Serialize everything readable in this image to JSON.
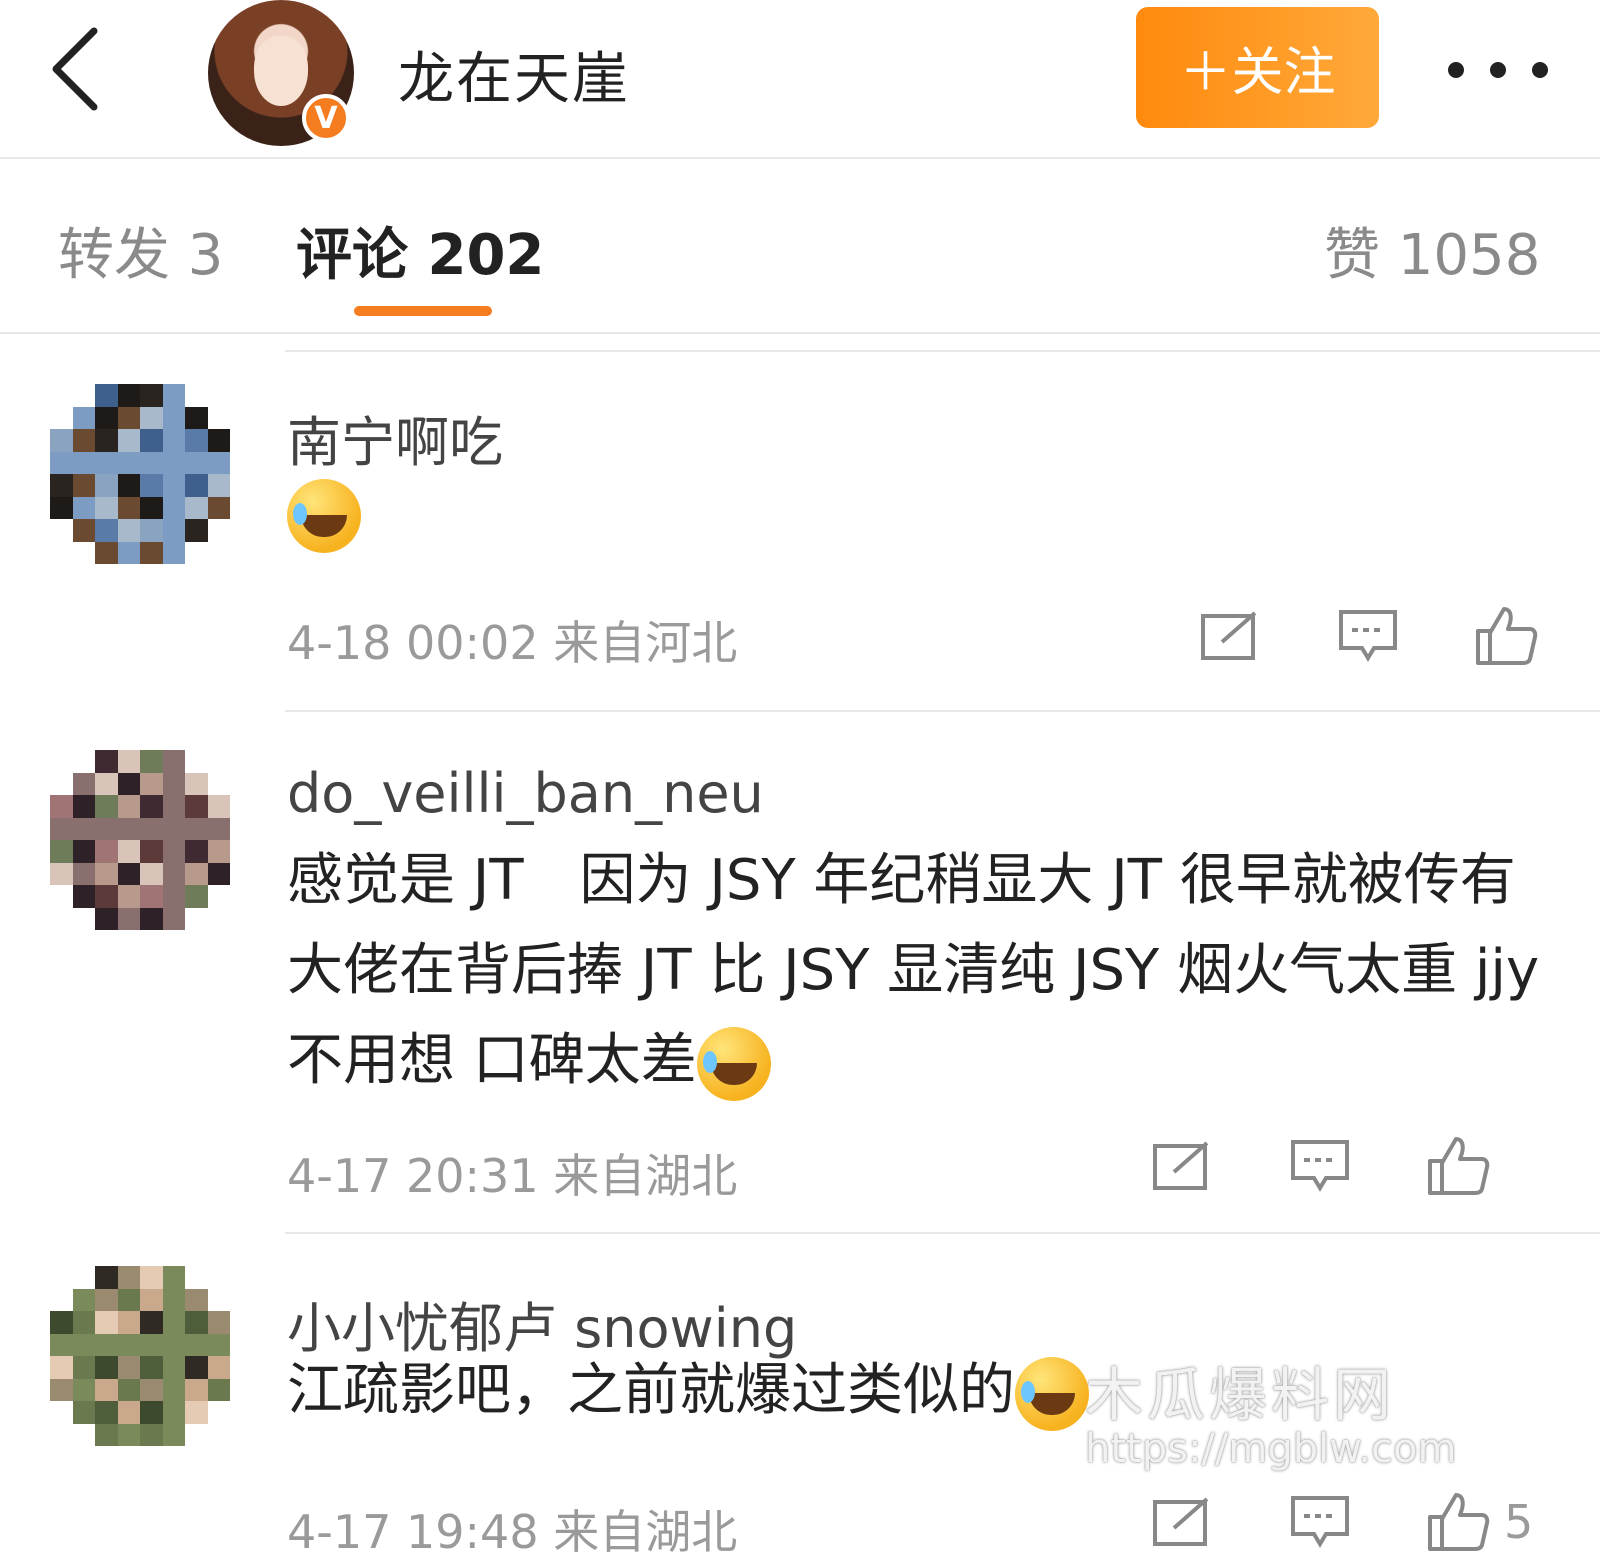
{
  "header": {
    "title": "龙在天崖",
    "verified_badge": "V",
    "follow_label": "＋关注"
  },
  "tabs": [
    {
      "label": "转发 3"
    },
    {
      "label": "评论 202"
    },
    {
      "label": "赞 1058"
    }
  ],
  "comments": [
    {
      "user": "南宁啊吃",
      "text": "",
      "time": "4-18 00:02",
      "source": "来自河北",
      "likes": ""
    },
    {
      "user": "do_veilli_ban_neu",
      "text": "感觉是 JT　因为 JSY 年纪稍显大 JT 很早就被传有大佬在背后捧 JT 比 JSY 显清纯 JSY 烟火气太重 jjy 不用想 口碑太差",
      "time": "4-17 20:31",
      "source": "来自湖北",
      "likes": ""
    },
    {
      "user": "小小忧郁卢 snowing",
      "text": "江疏影吧，之前就爆过类似的",
      "time": "4-17 19:48",
      "source": "来自湖北",
      "likes": "5"
    }
  ],
  "watermark": {
    "name": "木瓜爆料网",
    "url": "https://mgblw.com"
  },
  "colors": {
    "accent": "#f57c1f",
    "follow_gradient": [
      "#ff8a0d",
      "#ffa93a"
    ]
  },
  "icons": [
    "back-arrow-icon",
    "more-icon",
    "repost-icon",
    "comment-icon",
    "like-icon",
    "laugh-cry-emoji"
  ]
}
